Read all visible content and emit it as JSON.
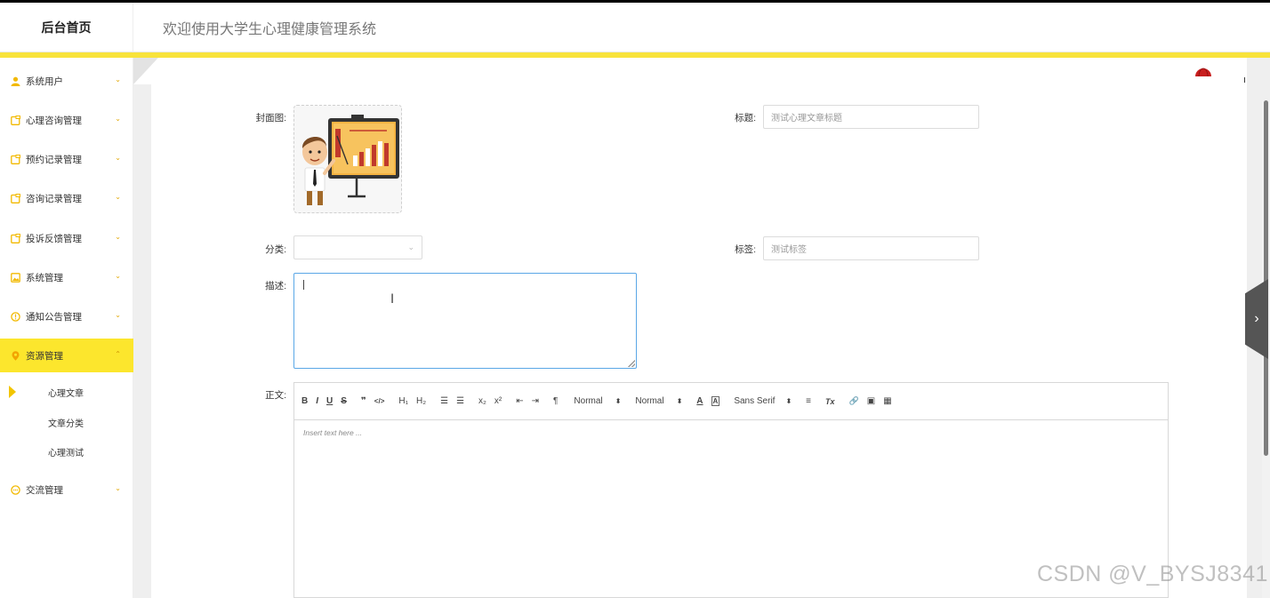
{
  "header": {
    "brand": "后台首页",
    "system_title": "欢迎使用大学生心理健康管理系统",
    "user_glyph": "ı"
  },
  "sidebar": {
    "items": [
      {
        "label": "系统用户",
        "icon": "user-icon"
      },
      {
        "label": "心理咨询管理",
        "icon": "folder-icon"
      },
      {
        "label": "预约记录管理",
        "icon": "folder-icon"
      },
      {
        "label": "咨询记录管理",
        "icon": "folder-icon"
      },
      {
        "label": "投诉反馈管理",
        "icon": "folder-icon"
      },
      {
        "label": "系统管理",
        "icon": "picture-icon"
      },
      {
        "label": "通知公告管理",
        "icon": "info-circle-icon"
      },
      {
        "label": "资源管理",
        "icon": "location-pin-icon",
        "active": true
      },
      {
        "label": "交流管理",
        "icon": "chat-icon"
      }
    ],
    "submenu": [
      {
        "label": "心理文章",
        "active": true
      },
      {
        "label": "文章分类"
      },
      {
        "label": "心理测试"
      }
    ]
  },
  "form": {
    "cover_label": "封面图:",
    "title_label": "标题:",
    "title_value": "测试心理文章标题",
    "category_label": "分类:",
    "category_value": "",
    "tags_label": "标签:",
    "tags_value": "测试标签",
    "desc_label": "描述:",
    "desc_value": "",
    "body_label": "正文:"
  },
  "editor": {
    "toolbar": {
      "bold": "B",
      "italic": "I",
      "underline": "U",
      "strike": "S",
      "quote": "❞",
      "code": "</>",
      "h1": "H₁",
      "h2": "H₂",
      "ordered_list": "☰",
      "bullet_list": "☰",
      "sub": "x₂",
      "sup": "x²",
      "outdent": "⇤",
      "indent": "⇥",
      "direction": "¶",
      "size_select": "Normal",
      "header_select": "Normal",
      "color": "A",
      "background": "A",
      "font_select": "Sans Serif",
      "align": "≡",
      "clean": "Tx",
      "link": "🔗",
      "image": "▣",
      "video": "▦"
    },
    "placeholder": "Insert text here ..."
  },
  "watermark": "CSDN @V_BYSJ8341",
  "colors": {
    "accent_yellow": "#f8e33a",
    "active_menu_bg": "#fce62d",
    "textarea_focus_border": "#5aa7e6"
  }
}
